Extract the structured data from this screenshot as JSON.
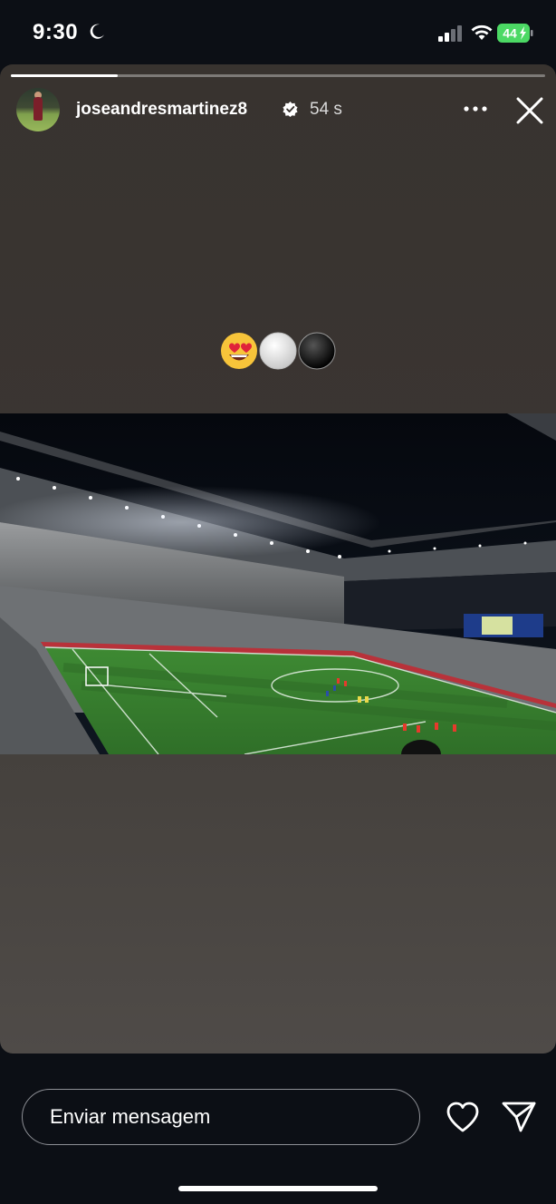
{
  "status_bar": {
    "time": "9:30",
    "battery_level": "44",
    "icons": [
      "moon-icon",
      "cellular-signal-icon",
      "wifi-icon",
      "battery-charging-icon"
    ]
  },
  "story": {
    "progress": 0.2,
    "username": "joseandresmartinez8",
    "time_ago": "54 s",
    "emojis": [
      "smiling-face-with-heart-eyes",
      "white-circle",
      "black-circle"
    ],
    "photo_description_icon": "stadium-photo"
  },
  "composer": {
    "placeholder": "Enviar mensagem"
  },
  "colors": {
    "background": "#0c0f15",
    "story_background": "#3a3532",
    "pitch": "#3f8a34"
  }
}
